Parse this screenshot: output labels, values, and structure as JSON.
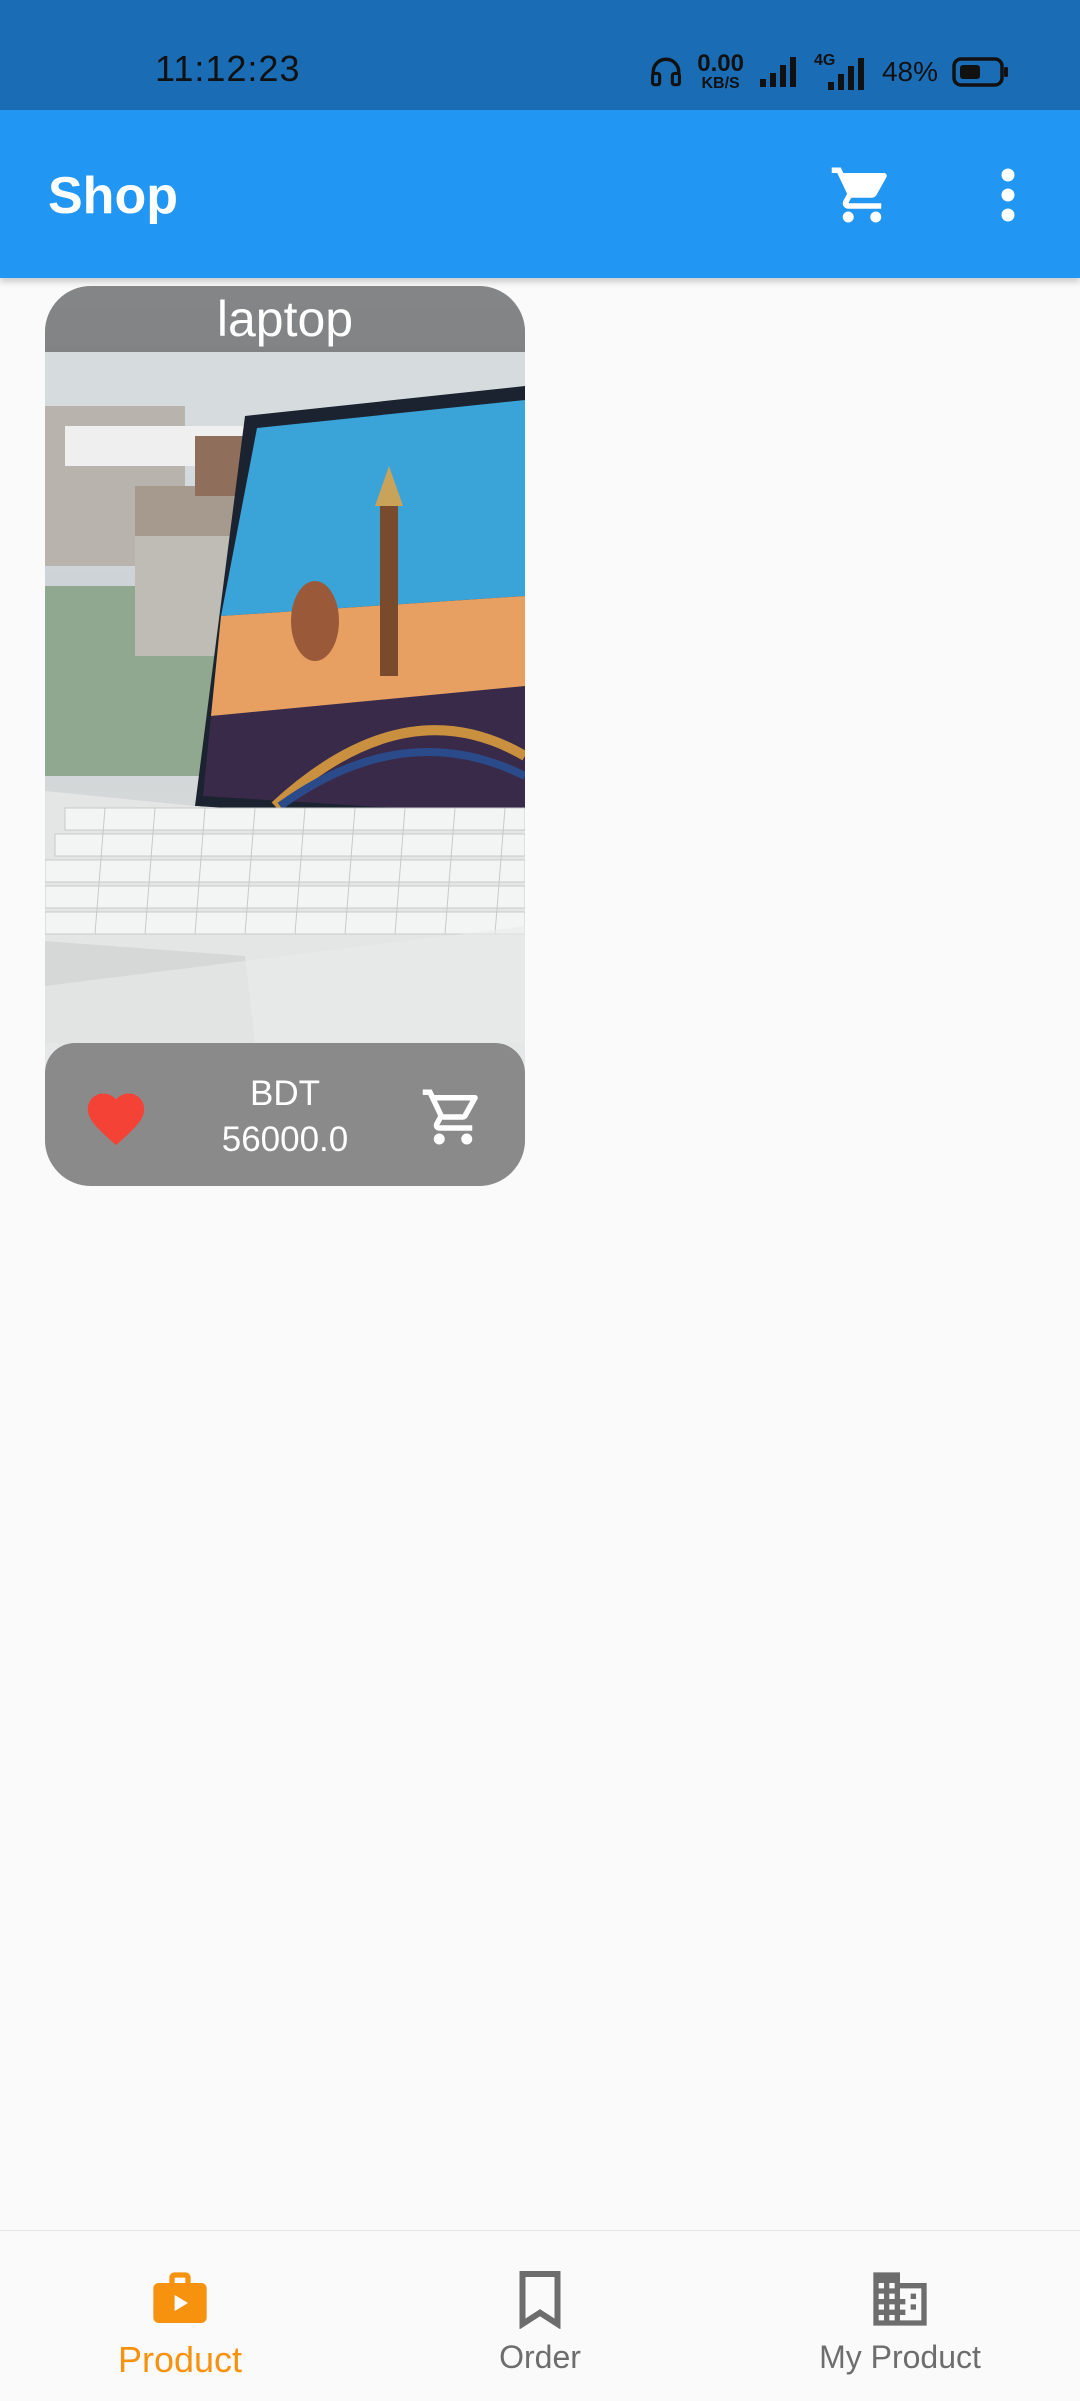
{
  "status_bar": {
    "time": "11:12:23",
    "net_speed_value": "0.00",
    "net_speed_unit": "KB/S",
    "network_type": "4G",
    "battery": "48%"
  },
  "app_bar": {
    "title": "Shop",
    "cart_icon": "cart-icon",
    "menu_icon": "more-vert-icon"
  },
  "products": [
    {
      "name": "laptop",
      "currency": "BDT",
      "price": "56000.0",
      "favorite": true
    }
  ],
  "bottom_nav": {
    "items": [
      {
        "label": "Product",
        "icon": "product-icon",
        "active": true
      },
      {
        "label": "Order",
        "icon": "bookmark-icon",
        "active": false
      },
      {
        "label": "My Product",
        "icon": "business-icon",
        "active": false
      }
    ]
  },
  "colors": {
    "status_bar": "#1a6db5",
    "app_bar": "#2196f3",
    "nav_active": "#f7920f",
    "nav_inactive": "#6d6d6d",
    "favorite": "#f44336",
    "background": "#fafafa"
  }
}
